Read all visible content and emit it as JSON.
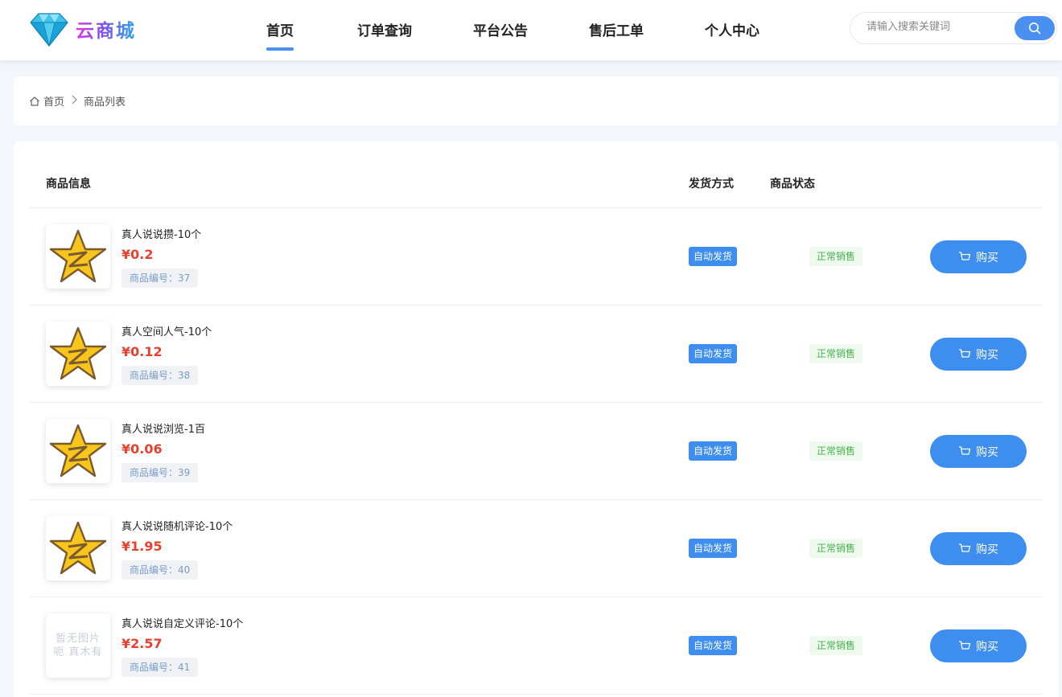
{
  "header": {
    "logo_text": "云商城",
    "nav": [
      {
        "label": "首页",
        "active": true
      },
      {
        "label": "订单查询",
        "active": false
      },
      {
        "label": "平台公告",
        "active": false
      },
      {
        "label": "售后工单",
        "active": false
      },
      {
        "label": "个人中心",
        "active": false
      }
    ],
    "search": {
      "placeholder": "请输入搜索关键词",
      "value": ""
    }
  },
  "breadcrumb": {
    "home": "首页",
    "current": "商品列表"
  },
  "table": {
    "headers": {
      "info": "商品信息",
      "shipping": "发货方式",
      "status": "商品状态"
    },
    "rows": [
      {
        "name": "真人说说攒-10个",
        "price": "¥0.2",
        "code": "商品编号：37",
        "shipping": "自动发货",
        "status": "正常销售",
        "buy": "购买",
        "image": "qzone-star-icon"
      },
      {
        "name": "真人空间人气-10个",
        "price": "¥0.12",
        "code": "商品编号：38",
        "shipping": "自动发货",
        "status": "正常销售",
        "buy": "购买",
        "image": "qzone-star-icon"
      },
      {
        "name": "真人说说浏览-1百",
        "price": "¥0.06",
        "code": "商品编号：39",
        "shipping": "自动发货",
        "status": "正常销售",
        "buy": "购买",
        "image": "qzone-star-icon"
      },
      {
        "name": "真人说说随机评论-10个",
        "price": "¥1.95",
        "code": "商品编号：40",
        "shipping": "自动发货",
        "status": "正常销售",
        "buy": "购买",
        "image": "qzone-star-icon"
      },
      {
        "name": "真人说说自定义评论-10个",
        "price": "¥2.57",
        "code": "商品编号：41",
        "shipping": "自动发货",
        "status": "正常销售",
        "buy": "购买",
        "image": "no-image",
        "no_image_text": [
          "暂无图片",
          "呃 真木有"
        ]
      }
    ]
  },
  "colors": {
    "accent": "#3d8eef",
    "price": "#e8402e",
    "status_text": "#48b04f",
    "status_bg": "#eefaee"
  }
}
